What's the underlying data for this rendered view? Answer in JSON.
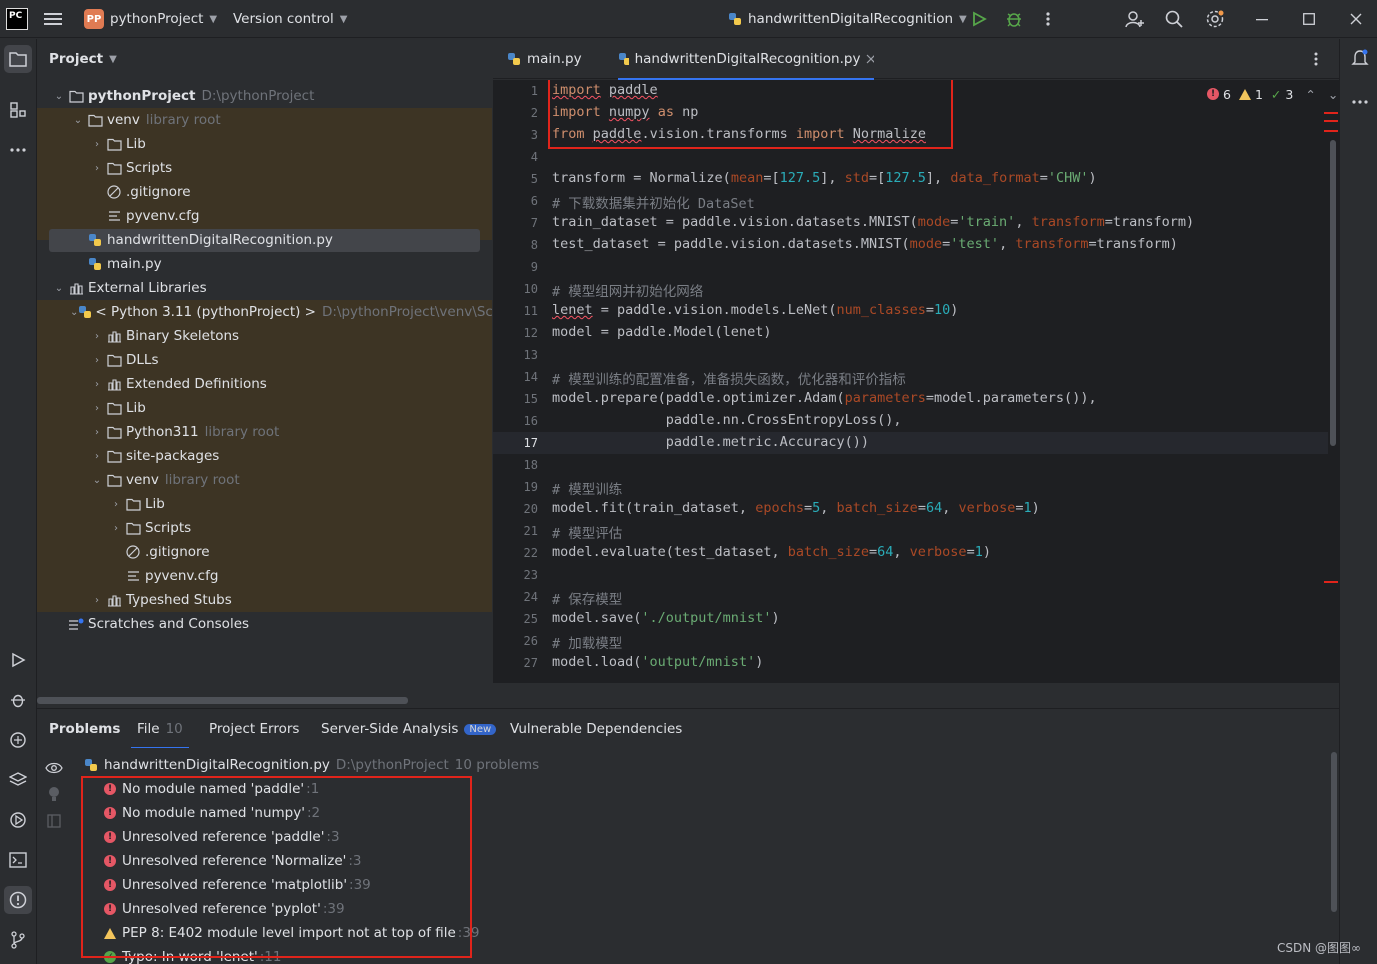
{
  "titlebar": {
    "app_badge": "PC",
    "project_badge": "PP",
    "project_name": "pythonProject",
    "vcs_label": "Version control",
    "run_config": "handwrittenDigitalRecognition"
  },
  "project_panel": {
    "title": "Project",
    "tree": [
      {
        "label": "pythonProject",
        "hint": "D:\\pythonProject"
      },
      {
        "label": "venv",
        "hint": "library root"
      },
      {
        "label": "Lib",
        "hint": ""
      },
      {
        "label": "Scripts",
        "hint": ""
      },
      {
        "label": ".gitignore",
        "hint": ""
      },
      {
        "label": "pyvenv.cfg",
        "hint": ""
      },
      {
        "label": "handwrittenDigitalRecognition.py",
        "hint": ""
      },
      {
        "label": "main.py",
        "hint": ""
      },
      {
        "label": "External Libraries",
        "hint": ""
      },
      {
        "label": "< Python 3.11 (pythonProject) >",
        "hint": "D:\\pythonProject\\venv\\Scrip"
      },
      {
        "label": "Binary Skeletons",
        "hint": ""
      },
      {
        "label": "DLLs",
        "hint": ""
      },
      {
        "label": "Extended Definitions",
        "hint": ""
      },
      {
        "label": "Lib",
        "hint": ""
      },
      {
        "label": "Python311",
        "hint": "library root"
      },
      {
        "label": "site-packages",
        "hint": ""
      },
      {
        "label": "venv",
        "hint": "library root"
      },
      {
        "label": "Lib",
        "hint": ""
      },
      {
        "label": "Scripts",
        "hint": ""
      },
      {
        "label": ".gitignore",
        "hint": ""
      },
      {
        "label": "pyvenv.cfg",
        "hint": ""
      },
      {
        "label": "Typeshed Stubs",
        "hint": ""
      },
      {
        "label": "Scratches and Consoles",
        "hint": ""
      }
    ]
  },
  "editor": {
    "tabs": [
      {
        "label": "main.py"
      },
      {
        "label": "handwrittenDigitalRecognition.py"
      }
    ],
    "inspection": {
      "errors": "6",
      "warnings": "1",
      "weak": "3"
    },
    "line_numbers": [
      "1",
      "2",
      "3",
      "4",
      "5",
      "6",
      "7",
      "8",
      "9",
      "10",
      "11",
      "12",
      "13",
      "14",
      "15",
      "16",
      "17",
      "18",
      "19",
      "20",
      "21",
      "22",
      "23",
      "24",
      "25",
      "26",
      "27"
    ],
    "current_line": "17"
  },
  "problems": {
    "tabs": [
      {
        "label": "Problems"
      },
      {
        "label": "File",
        "count": "10"
      },
      {
        "label": "Project Errors"
      },
      {
        "label": "Server-Side Analysis",
        "badge": "New"
      },
      {
        "label": "Vulnerable Dependencies"
      }
    ],
    "file": {
      "name": "handwrittenDigitalRecognition.py",
      "path": "D:\\pythonProject",
      "count": "10 problems"
    },
    "items": [
      {
        "text": "No module named 'paddle'",
        "line": ":1",
        "level": "error"
      },
      {
        "text": "No module named 'numpy'",
        "line": ":2",
        "level": "error"
      },
      {
        "text": "Unresolved reference 'paddle'",
        "line": ":3",
        "level": "error"
      },
      {
        "text": "Unresolved reference 'Normalize'",
        "line": ":3",
        "level": "error"
      },
      {
        "text": "Unresolved reference 'matplotlib'",
        "line": ":39",
        "level": "error"
      },
      {
        "text": "Unresolved reference 'pyplot'",
        "line": ":39",
        "level": "error"
      },
      {
        "text": "PEP 8: E402 module level import not at top of file",
        "line": ":39",
        "level": "warning"
      },
      {
        "text": "Typo: In word 'lenet'",
        "line": ":11",
        "level": "typo"
      }
    ]
  },
  "watermark": "CSDN @图图∞"
}
